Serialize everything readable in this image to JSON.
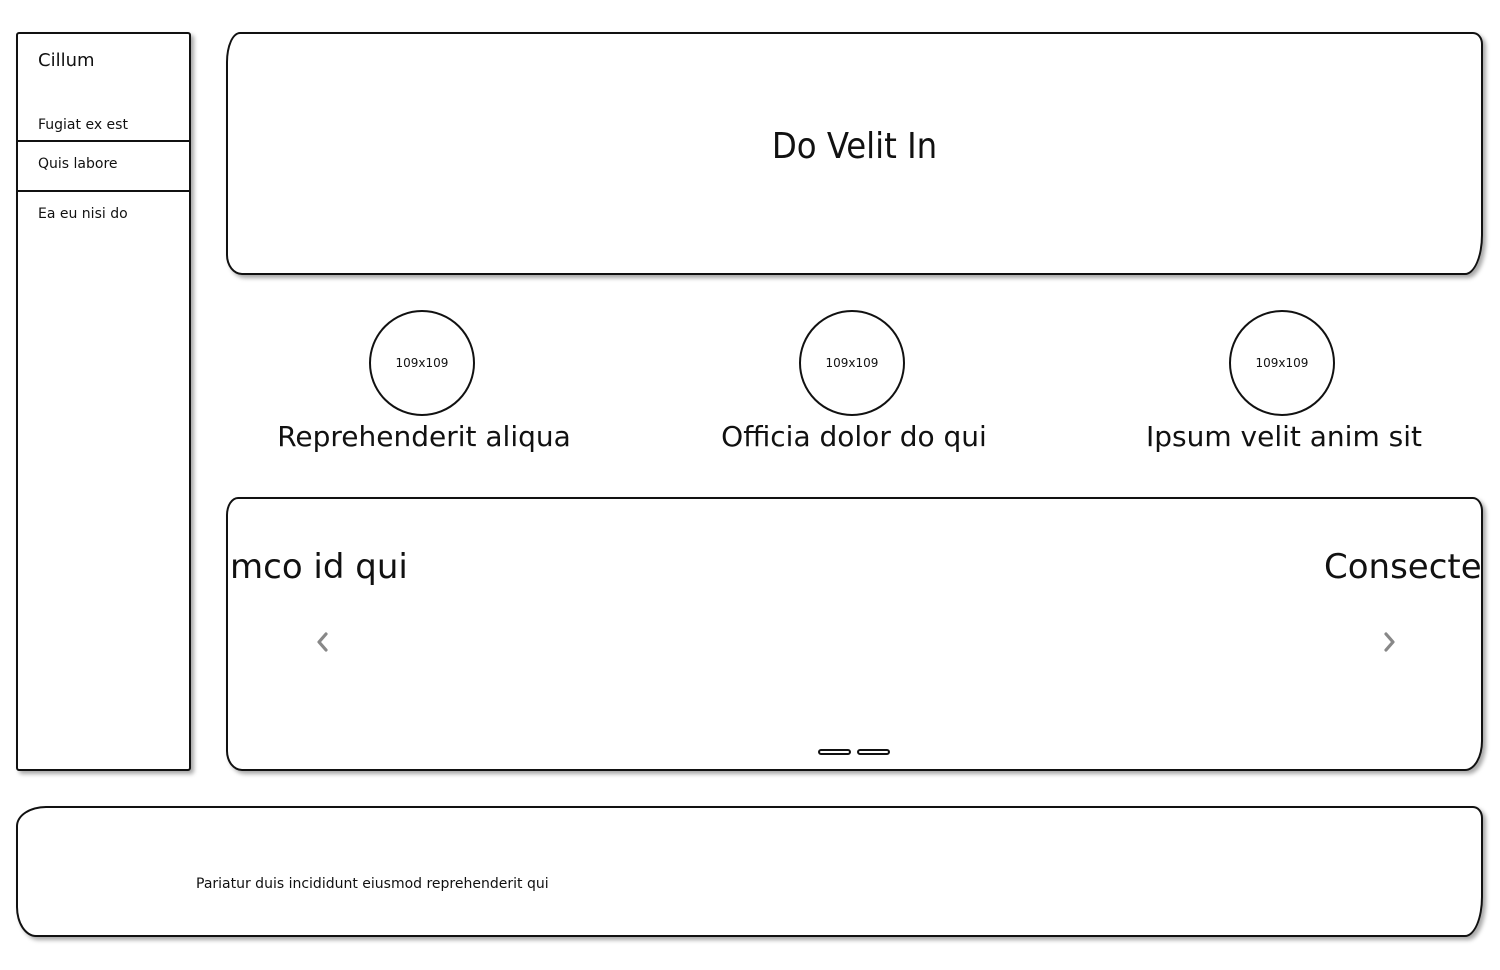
{
  "sidebar": {
    "title": "Cillum",
    "items": [
      {
        "label": "Fugiat ex est"
      },
      {
        "label": "Quis labore"
      },
      {
        "label": "Ea eu nisi do"
      }
    ]
  },
  "header": {
    "title": "Do Velit In"
  },
  "features": [
    {
      "image_label": "109x109",
      "caption": "Reprehenderit aliqua"
    },
    {
      "image_label": "109x109",
      "caption": "Officia dolor do qui"
    },
    {
      "image_label": "109x109",
      "caption": "Ipsum velit anim sit"
    }
  ],
  "carousel": {
    "slide_left_text": "mco id qui",
    "slide_right_text": "Consectet",
    "prev_icon": "chevron-left-icon",
    "next_icon": "chevron-right-icon",
    "arrow_color": "#888888",
    "dots": 2
  },
  "footer": {
    "text": "Pariatur duis incididunt eiusmod reprehenderit qui"
  }
}
